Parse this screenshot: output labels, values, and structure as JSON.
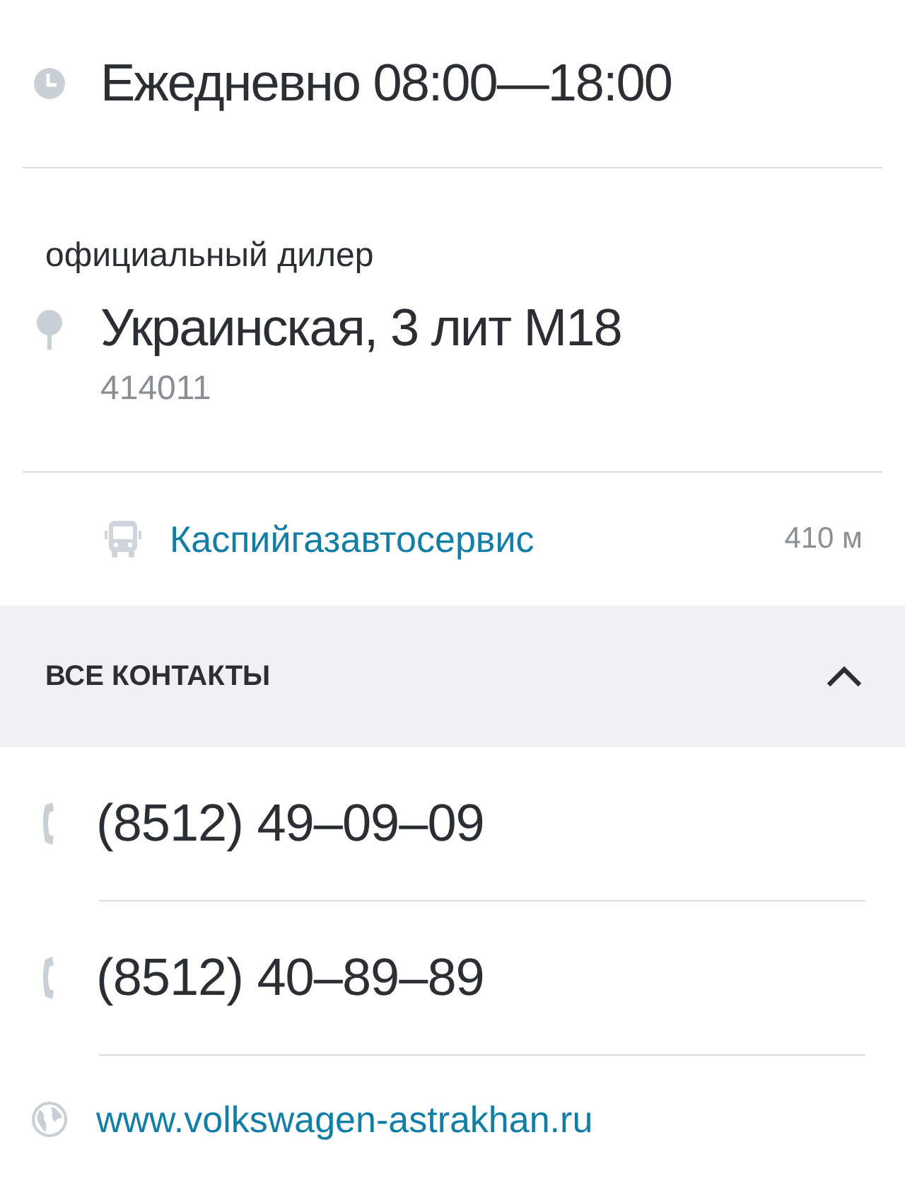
{
  "hours": {
    "text": "Ежедневно 08:00—18:00"
  },
  "address": {
    "label": "официальный дилер",
    "street": "Украинская, 3 лит М18",
    "postcode": "414011"
  },
  "transit": {
    "station": "Каспийгазавтосервис",
    "distance": "410 м"
  },
  "contacts_header": {
    "title": "ВСЕ КОНТАКТЫ",
    "expanded": true
  },
  "contacts": [
    {
      "kind": "phone",
      "text": "(8512) 49–09–09"
    },
    {
      "kind": "phone",
      "text": "(8512) 40–89–89"
    },
    {
      "kind": "web",
      "text": "www.volkswagen-astrakhan.ru"
    }
  ]
}
